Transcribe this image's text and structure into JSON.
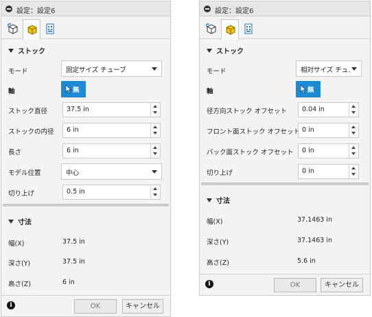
{
  "left": {
    "title": "設定：設定6",
    "section_stock": "ストック",
    "mode_label": "モード",
    "mode_value": "固定サイズ チューブ",
    "axis_label": "軸",
    "axis_button_text": "無",
    "outer_diameter_label": "ストック直径",
    "outer_diameter_value": "37.5 in",
    "inner_diameter_label": "ストックの内径",
    "inner_diameter_value": "6 in",
    "length_label": "長さ",
    "length_value": "6 in",
    "model_position_label": "モデル位置",
    "model_position_value": "中心",
    "round_up_label": "切り上げ",
    "round_up_value": "0.5 in",
    "section_dimensions": "寸法",
    "width_label": "幅(X)",
    "width_value": "37.5 in",
    "depth_label": "深さ(Y)",
    "depth_value": "37.5 in",
    "height_label": "高さ(Z)",
    "height_value": "6 in",
    "ok_label": "OK",
    "cancel_label": "キャンセル"
  },
  "right": {
    "title": "設定：設定6",
    "section_stock": "ストック",
    "mode_label": "モード",
    "mode_value": "相対サイズ チュ...",
    "axis_label": "軸",
    "axis_button_text": "無",
    "radial_offset_label": "径方向ストック オフセット",
    "radial_offset_value": "0.04 in",
    "front_offset_label": "フロント面ストック オフセット",
    "front_offset_value": "0 in",
    "back_offset_label": "バック面ストック オフセット",
    "back_offset_value": "0 in",
    "round_up_label": "切り上げ",
    "round_up_value": "0 in",
    "section_dimensions": "寸法",
    "width_label": "幅(X)",
    "width_value": "37.1463 in",
    "depth_label": "深さ(Y)",
    "depth_value": "37.1463 in",
    "height_label": "高さ(Z)",
    "height_value": "5.6 in",
    "ok_label": "OK",
    "cancel_label": "キャンセル"
  },
  "icons": {
    "tab_1": "setup-box-icon",
    "tab_2": "stock-cube-icon",
    "tab_3": "post-process-icon",
    "axis": "cursor-arrow-icon",
    "title": "collapse-minus-icon",
    "info": "info-icon"
  },
  "colors": {
    "accent_blue": "#1e8ad6",
    "stock_yellow": "#f1c40f"
  }
}
